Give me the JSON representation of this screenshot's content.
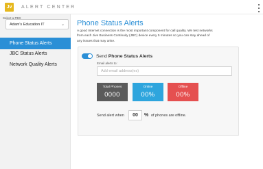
{
  "app": {
    "logo_text": "Jv",
    "title": "ALERT CENTER"
  },
  "sidebar": {
    "pbx_label": "Select a PBX",
    "pbx_value": "Adam's Education IT",
    "items": [
      {
        "label": "Phone Status Alerts",
        "active": true
      },
      {
        "label": "JBC Status Alerts",
        "active": false
      },
      {
        "label": "Network Quality Alerts",
        "active": false
      }
    ]
  },
  "main": {
    "title": "Phone Status Alerts",
    "description": "A good Internet connection is the most important component for call quality. We test networks from each Jive Business Continuity (JBC) device every 5 minutes so you can stay ahead of any issues that may arise.",
    "send_prefix": "Send",
    "send_bold": "Phone Status Alerts",
    "toggle_on": true,
    "email_label": "Email alerts to:",
    "email_placeholder": "Add email address(es)",
    "stats": {
      "total_label": "Total Phones",
      "total_value": "0000",
      "online_label": "Online",
      "online_value": "00%",
      "offline_label": "Offline",
      "offline_value": "00%"
    },
    "threshold_prefix": "Send alert when",
    "threshold_value": "00",
    "threshold_unit": "%",
    "threshold_suffix": "of phones are offline."
  },
  "colors": {
    "accent": "#2b8fd6",
    "logo": "#e6b81e",
    "total": "#5b5b5b",
    "online": "#2ea5dd",
    "offline": "#e55050"
  }
}
